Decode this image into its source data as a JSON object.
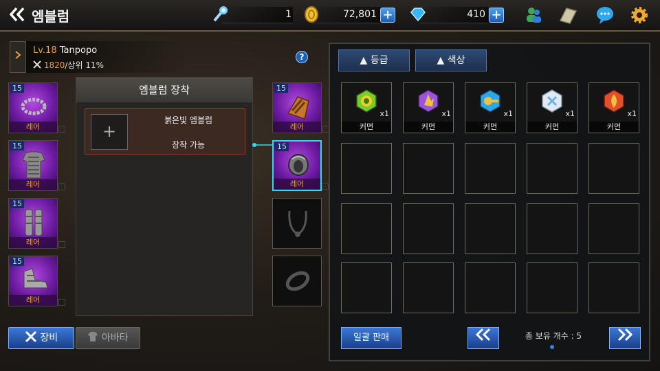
{
  "header": {
    "back_icon": "double-chevron-left-icon",
    "title": "엠블럼"
  },
  "resources": [
    {
      "icon": "torch-icon",
      "value": "1"
    },
    {
      "icon": "gold-coin-icon",
      "value": "72,801"
    },
    {
      "icon": "diamond-icon",
      "value": "410"
    }
  ],
  "top_icons": [
    "friends-icon",
    "map-scroll-icon",
    "chat-bubble-icon",
    "gear-icon"
  ],
  "player": {
    "level_prefix": "Lv.18",
    "name": "Tanpopo",
    "power": "1820",
    "rank": "/상위 11%"
  },
  "help_label": "?",
  "left_slots": [
    {
      "level": "15",
      "rarity": "레어",
      "icon": "bracelet-icon"
    },
    {
      "level": "15",
      "rarity": "레어",
      "icon": "chainmail-armor-icon"
    },
    {
      "level": "15",
      "rarity": "레어",
      "icon": "greaves-icon"
    },
    {
      "level": "15",
      "rarity": "레어",
      "icon": "boots-icon"
    }
  ],
  "right_slots": [
    {
      "level": "15",
      "rarity": "레어",
      "icon": "gauntlet-icon"
    },
    {
      "level": "15",
      "rarity": "레어",
      "icon": "ring-icon"
    }
  ],
  "emblem_panel": {
    "title": "엠블럼 장착",
    "slot_name": "붉은빛 엠블럼",
    "slot_status": "장착 가능",
    "plus": "+"
  },
  "tabs": {
    "equip": "장비",
    "avatar": "아바타"
  },
  "filters": {
    "grade": "▲ 등급",
    "color": "▲ 색상"
  },
  "inventory": [
    {
      "grade": "커먼",
      "count": "x1",
      "color": "#7ccb2e",
      "icon": "green-emblem-icon"
    },
    {
      "grade": "커먼",
      "count": "x1",
      "color": "#9a55d8",
      "icon": "purple-emblem-icon"
    },
    {
      "grade": "커먼",
      "count": "x1",
      "color": "#2fa6e6",
      "icon": "blue-emblem-icon"
    },
    {
      "grade": "커먼",
      "count": "x1",
      "color": "#dfe9f2",
      "icon": "white-emblem-icon"
    },
    {
      "grade": "커먼",
      "count": "x1",
      "color": "#e0502a",
      "icon": "red-emblem-icon"
    }
  ],
  "footer": {
    "sell_all": "일괄 판매",
    "total": "총 보유 개수 : 5",
    "prev": "«",
    "next": "»"
  }
}
